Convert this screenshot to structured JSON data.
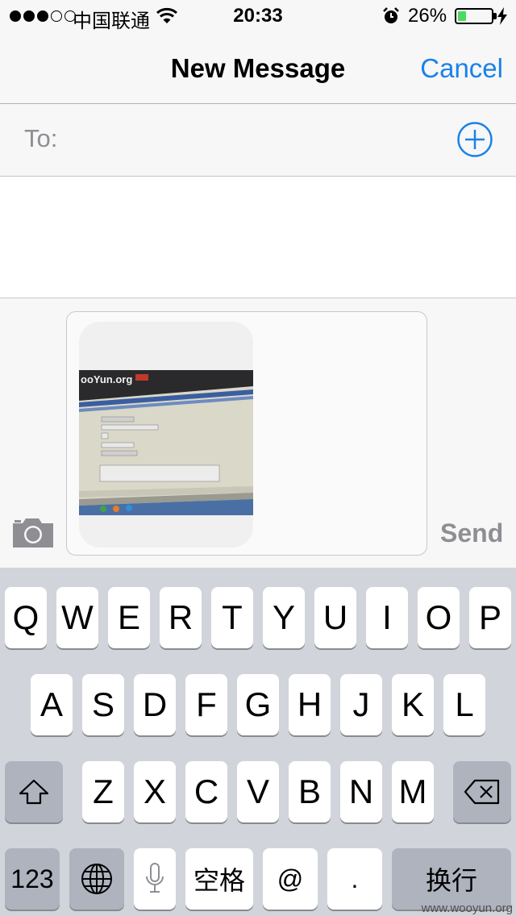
{
  "status_bar": {
    "signal_bars_filled": 3,
    "signal_bars_total": 5,
    "carrier": "中国联通",
    "wifi_icon": "wifi-icon",
    "time": "20:33",
    "alarm_icon": "alarm-clock-icon",
    "battery_percent": "26%",
    "battery_level": 0.26,
    "charging_icon": "charging-bolt-icon",
    "battery_color": "#4cd964"
  },
  "nav": {
    "title": "New Message",
    "cancel_label": "Cancel",
    "accent_color": "#1a82e8"
  },
  "recipient": {
    "label": "To:",
    "value": "",
    "add_icon": "add-contact-plus-icon"
  },
  "compose": {
    "camera_icon": "camera-icon",
    "attachment": "photo-thumbnail",
    "send_label": "Send"
  },
  "keyboard": {
    "row1": [
      "Q",
      "W",
      "E",
      "R",
      "T",
      "Y",
      "U",
      "I",
      "O",
      "P"
    ],
    "row2": [
      "A",
      "S",
      "D",
      "F",
      "G",
      "H",
      "J",
      "K",
      "L"
    ],
    "row3": [
      "Z",
      "X",
      "C",
      "V",
      "B",
      "N",
      "M"
    ],
    "shift_icon": "shift-arrow-icon",
    "delete_icon": "backspace-icon",
    "numbers_label": "123",
    "globe_icon": "globe-icon",
    "mic_icon": "microphone-icon",
    "space_label": "空格",
    "at_label": "@",
    "dot_label": ".",
    "return_label": "换行"
  },
  "watermark": "www.wooyun.org"
}
